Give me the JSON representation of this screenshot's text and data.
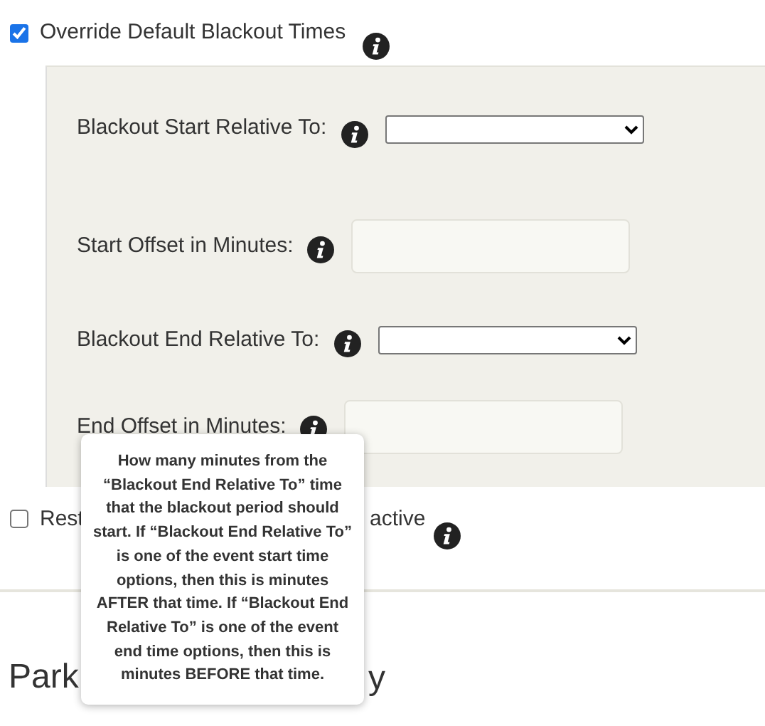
{
  "override": {
    "label": "Override Default Blackout Times",
    "checked": true
  },
  "fields": [
    {
      "kind": "select",
      "label": "Blackout Start Relative To:"
    },
    {
      "kind": "input",
      "label": "Start Offset in Minutes:"
    },
    {
      "kind": "select",
      "label": "Blackout End Relative To:"
    },
    {
      "kind": "input",
      "label": "End Offset in Minutes:"
    }
  ],
  "tooltip": "How many minutes from the “Blackout End Relative To” time that the blackout period should start. If “Blackout End Relative To” is one of the event start time options, then this is minutes AFTER that time. If “Blackout End Relative To” is one of the event end time options, then this is minutes BEFORE that time.",
  "restrict": {
    "label_start": "Rest",
    "label_end": "active",
    "checked": false
  },
  "heading": {
    "start": "Park",
    "end": "y"
  }
}
